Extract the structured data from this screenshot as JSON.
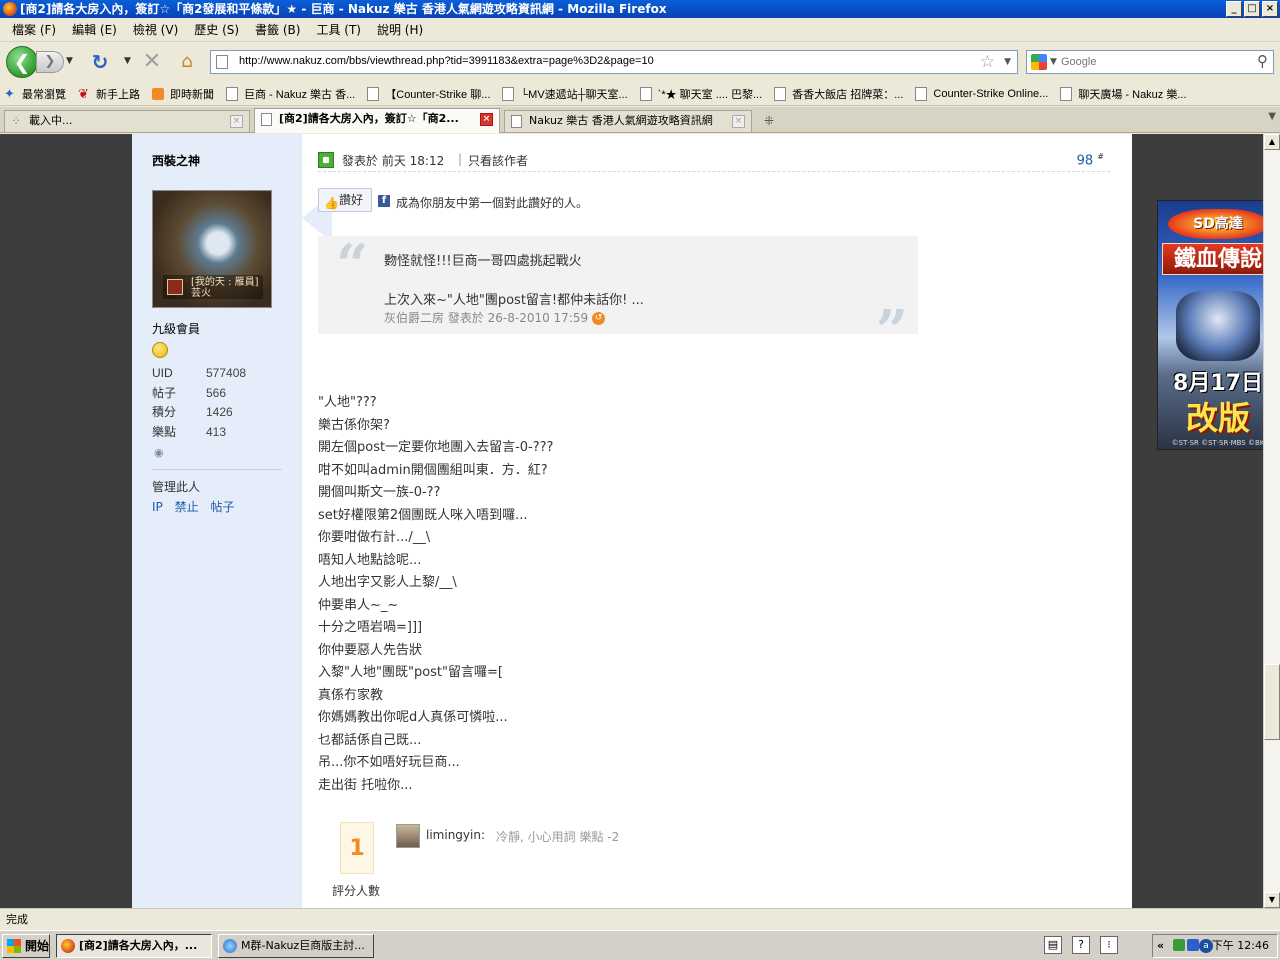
{
  "window": {
    "title": "[商2]請各大房入內，簽訂☆「商2發展和平條款」★ - 巨商 - Nakuz 樂古 香港人氣網遊攻略資訊網 - Mozilla Firefox",
    "min": "_",
    "max": "□",
    "close": "×"
  },
  "menu": [
    "檔案 (F)",
    "編輯 (E)",
    "檢視 (V)",
    "歷史 (S)",
    "書籤 (B)",
    "工具 (T)",
    "說明 (H)"
  ],
  "nav": {
    "back_symbol": "❮",
    "forward_symbol": "❯",
    "url": "http://www.nakuz.com/bbs/viewthread.php?tid=3991183&extra=page%3D2&page=10",
    "search_placeholder": "Google"
  },
  "bookmarks": [
    "最常瀏覽",
    "新手上路",
    "即時新聞",
    "巨商 - Nakuz 樂古 香...",
    "【Counter-Strike 聊...",
    "└MV速遞站┼聊天室...",
    "`*★ 聊天室 .... 巴黎...",
    "香香大飯店 招牌菜：...",
    "Counter-Strike Online...",
    "聊天廣場 - Nakuz 樂..."
  ],
  "tabs": [
    {
      "label": "載入中..."
    },
    {
      "label": "[商2]請各大房入內，簽訂☆「商2..."
    },
    {
      "label": "Nakuz 樂古 香港人氣網遊攻略資訊網"
    }
  ],
  "user": {
    "name": "西裝之神",
    "avatar_caption": "[我的天 : 雁員]\n芸火",
    "rank": "九級會員",
    "stats": [
      {
        "k": "UID",
        "v": "577408"
      },
      {
        "k": "帖子",
        "v": "566"
      },
      {
        "k": "積分",
        "v": "1426"
      },
      {
        "k": "樂點",
        "v": "413"
      }
    ],
    "manage_title": "管理此人",
    "manage_links": [
      "IP",
      "禁止",
      "帖子"
    ]
  },
  "post": {
    "date": "發表於 前天 18:12",
    "sep": "|",
    "author_only": "只看該作者",
    "floor": "98",
    "floor_mark": "#",
    "like_label": "讚好",
    "fb_text": "成為你朋友中第一個對此讚好的人。",
    "quote": {
      "line1": "覅怪就怪!!!巨商一哥四處挑起戰火",
      "line2": "上次入來~\"人地\"團post留言!都仲未話你! ...",
      "meta": "灰伯爵二房 發表於 26-8-2010 17:59"
    },
    "body": [
      "\"人地\"???",
      "樂古係你架?",
      "開左個post一定要你地團入去留言-0-???",
      "咁不如叫admin開個團組叫東．方．紅?",
      "開個叫斯文一族-0-??",
      "set好權限第2個團既人咪入唔到囉...",
      "你要咁做冇計.../__\\",
      "唔知人地點諗呢...",
      "人地出字又影人上黎/__\\",
      "仲要串人~_~",
      "十分之唔岩喎=]]]",
      "你仲要惡人先告狀",
      "入黎\"人地\"團既\"post\"留言囉=[",
      "真係冇家教",
      "你媽媽教出你呢d人真係可憐啦...",
      "乜都話係自己既...",
      "吊...你不如唔好玩巨商...",
      "走出街 托啦你..."
    ],
    "rating": {
      "count": "1",
      "label": "評分人數",
      "user": "limingyin:",
      "reason": "冷靜, 小心用詞 樂點 -2"
    }
  },
  "ad": {
    "logo": "SD高達",
    "title": "鐵血傳說",
    "date": "8月17日",
    "change": "改版",
    "copy": "©ST·SR ©ST·SR·MBS ©BK"
  },
  "statusbar": {
    "text": "完成"
  },
  "taskbar": {
    "start": "開始",
    "tasks": [
      "[商2]請各大房入內，...",
      "M群-Nakuz巨商版主討..."
    ],
    "clock": "下午 12:46"
  }
}
